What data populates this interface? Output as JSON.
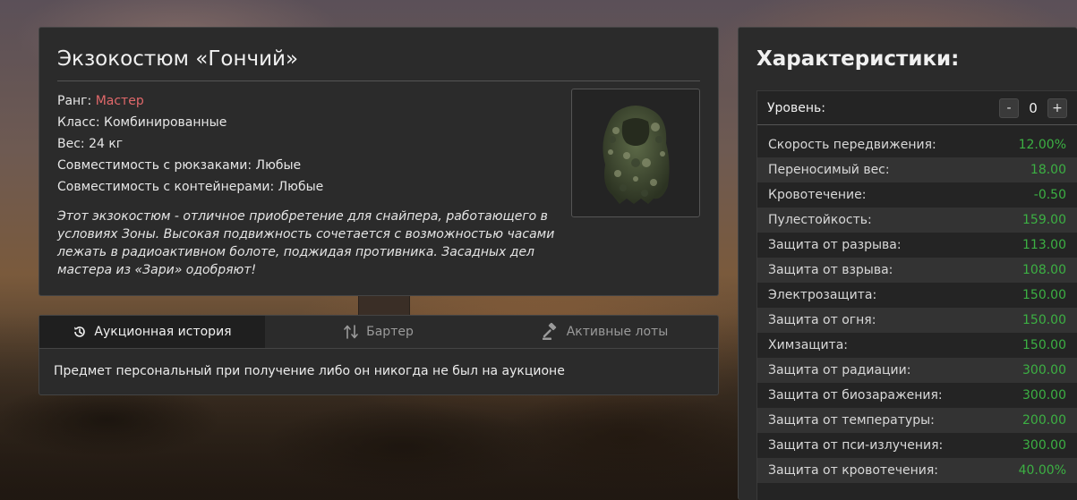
{
  "item": {
    "title": "Экзокостюм «Гончий»",
    "rank_label": "Ранг:",
    "rank_value": "Мастер",
    "class_text": "Класс: Комбинированные",
    "weight_text": "Вес: 24 кг",
    "backpack_text": "Совместимость с рюкзаками: Любые",
    "container_text": "Совместимость с контейнерами: Любые",
    "description": "Этот экзокостюм - отличное приобретение для снайпера, работающего в условиях Зоны. Высокая подвижность сочетается с возможностью часами лежать в радиоактивном болоте, поджидая противника. Засадных дел мастера из «Зари» одобряют!",
    "image_icon": "ghillie-suit-icon"
  },
  "tabs": [
    {
      "label": "Аукционная история",
      "icon": "history-icon",
      "active": true
    },
    {
      "label": "Бартер",
      "icon": "swap-arrows-icon",
      "active": false
    },
    {
      "label": "Активные лоты",
      "icon": "gavel-icon",
      "active": false
    }
  ],
  "tab_content": "Предмет персональный при получение либо он никогда не был на аукционе",
  "stats": {
    "title": "Характеристики:",
    "level_label": "Уровень:",
    "level_value": "0",
    "minus_label": "-",
    "plus_label": "+",
    "rows": [
      {
        "name": "Скорость передвижения:",
        "value": "12.00%"
      },
      {
        "name": "Переносимый вес:",
        "value": "18.00"
      },
      {
        "name": "Кровотечение:",
        "value": "-0.50"
      },
      {
        "name": "Пулестойкость:",
        "value": "159.00"
      },
      {
        "name": "Защита от разрыва:",
        "value": "113.00"
      },
      {
        "name": "Защита от взрыва:",
        "value": "108.00"
      },
      {
        "name": "Электрозащита:",
        "value": "150.00"
      },
      {
        "name": "Защита от огня:",
        "value": "150.00"
      },
      {
        "name": "Химзащита:",
        "value": "150.00"
      },
      {
        "name": "Защита от радиации:",
        "value": "300.00"
      },
      {
        "name": "Защита от биозаражения:",
        "value": "300.00"
      },
      {
        "name": "Защита от температуры:",
        "value": "200.00"
      },
      {
        "name": "Защита от пси-излучения:",
        "value": "300.00"
      },
      {
        "name": "Защита от кровотечения:",
        "value": "40.00%"
      }
    ]
  },
  "colors": {
    "rank": "#e0686a",
    "stat_value": "#3cb043",
    "panel_bg": "#2b2b2b"
  }
}
